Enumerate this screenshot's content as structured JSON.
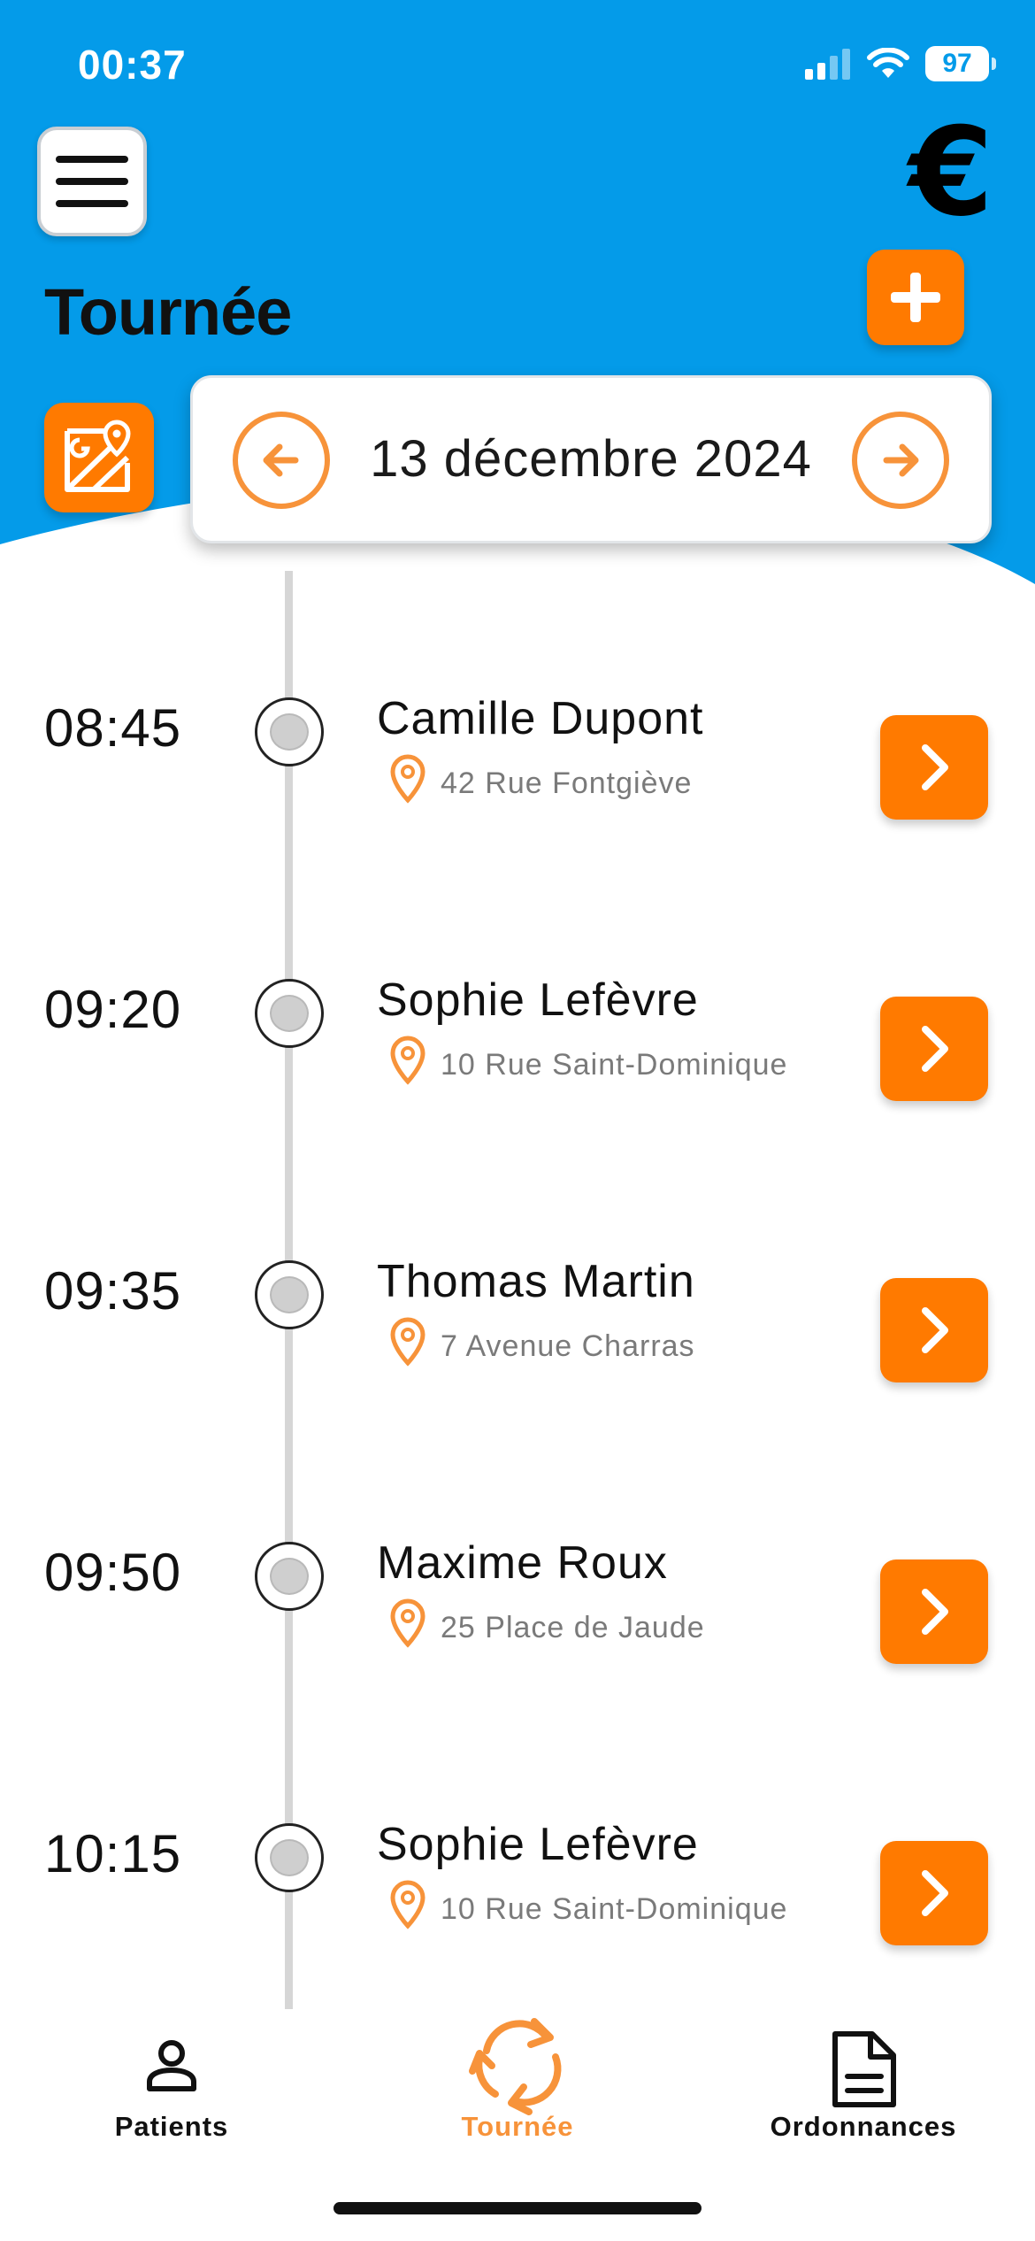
{
  "status_bar": {
    "time": "00:37",
    "battery": "97"
  },
  "colors": {
    "header_blue": "#049BE9",
    "accent_orange": "#FF7A00",
    "outline_orange": "#F7933A"
  },
  "header": {
    "title": "Tournée",
    "menu_icon": "hamburger-menu-icon",
    "currency_icon": "euro-icon",
    "add_icon": "plus-icon",
    "map_icon": "google-maps-icon"
  },
  "date_nav": {
    "date": "13 décembre 2024",
    "prev_icon": "arrow-left-icon",
    "next_icon": "arrow-right-icon"
  },
  "appointments": [
    {
      "time": "08:45",
      "name": "Camille Dupont",
      "address": "42 Rue Fontgiève"
    },
    {
      "time": "09:20",
      "name": "Sophie Lefèvre",
      "address": "10 Rue Saint-Dominique"
    },
    {
      "time": "09:35",
      "name": "Thomas Martin",
      "address": "7 Avenue Charras"
    },
    {
      "time": "09:50",
      "name": "Maxime Roux",
      "address": "25 Place de Jaude"
    },
    {
      "time": "10:15",
      "name": "Sophie Lefèvre",
      "address": "10 Rue Saint-Dominique"
    }
  ],
  "tab_bar": {
    "items": [
      {
        "label": "Patients",
        "icon": "person-icon",
        "active": false
      },
      {
        "label": "Tournée",
        "icon": "refresh-cycle-icon",
        "active": true
      },
      {
        "label": "Ordonnances",
        "icon": "document-icon",
        "active": false
      }
    ]
  }
}
